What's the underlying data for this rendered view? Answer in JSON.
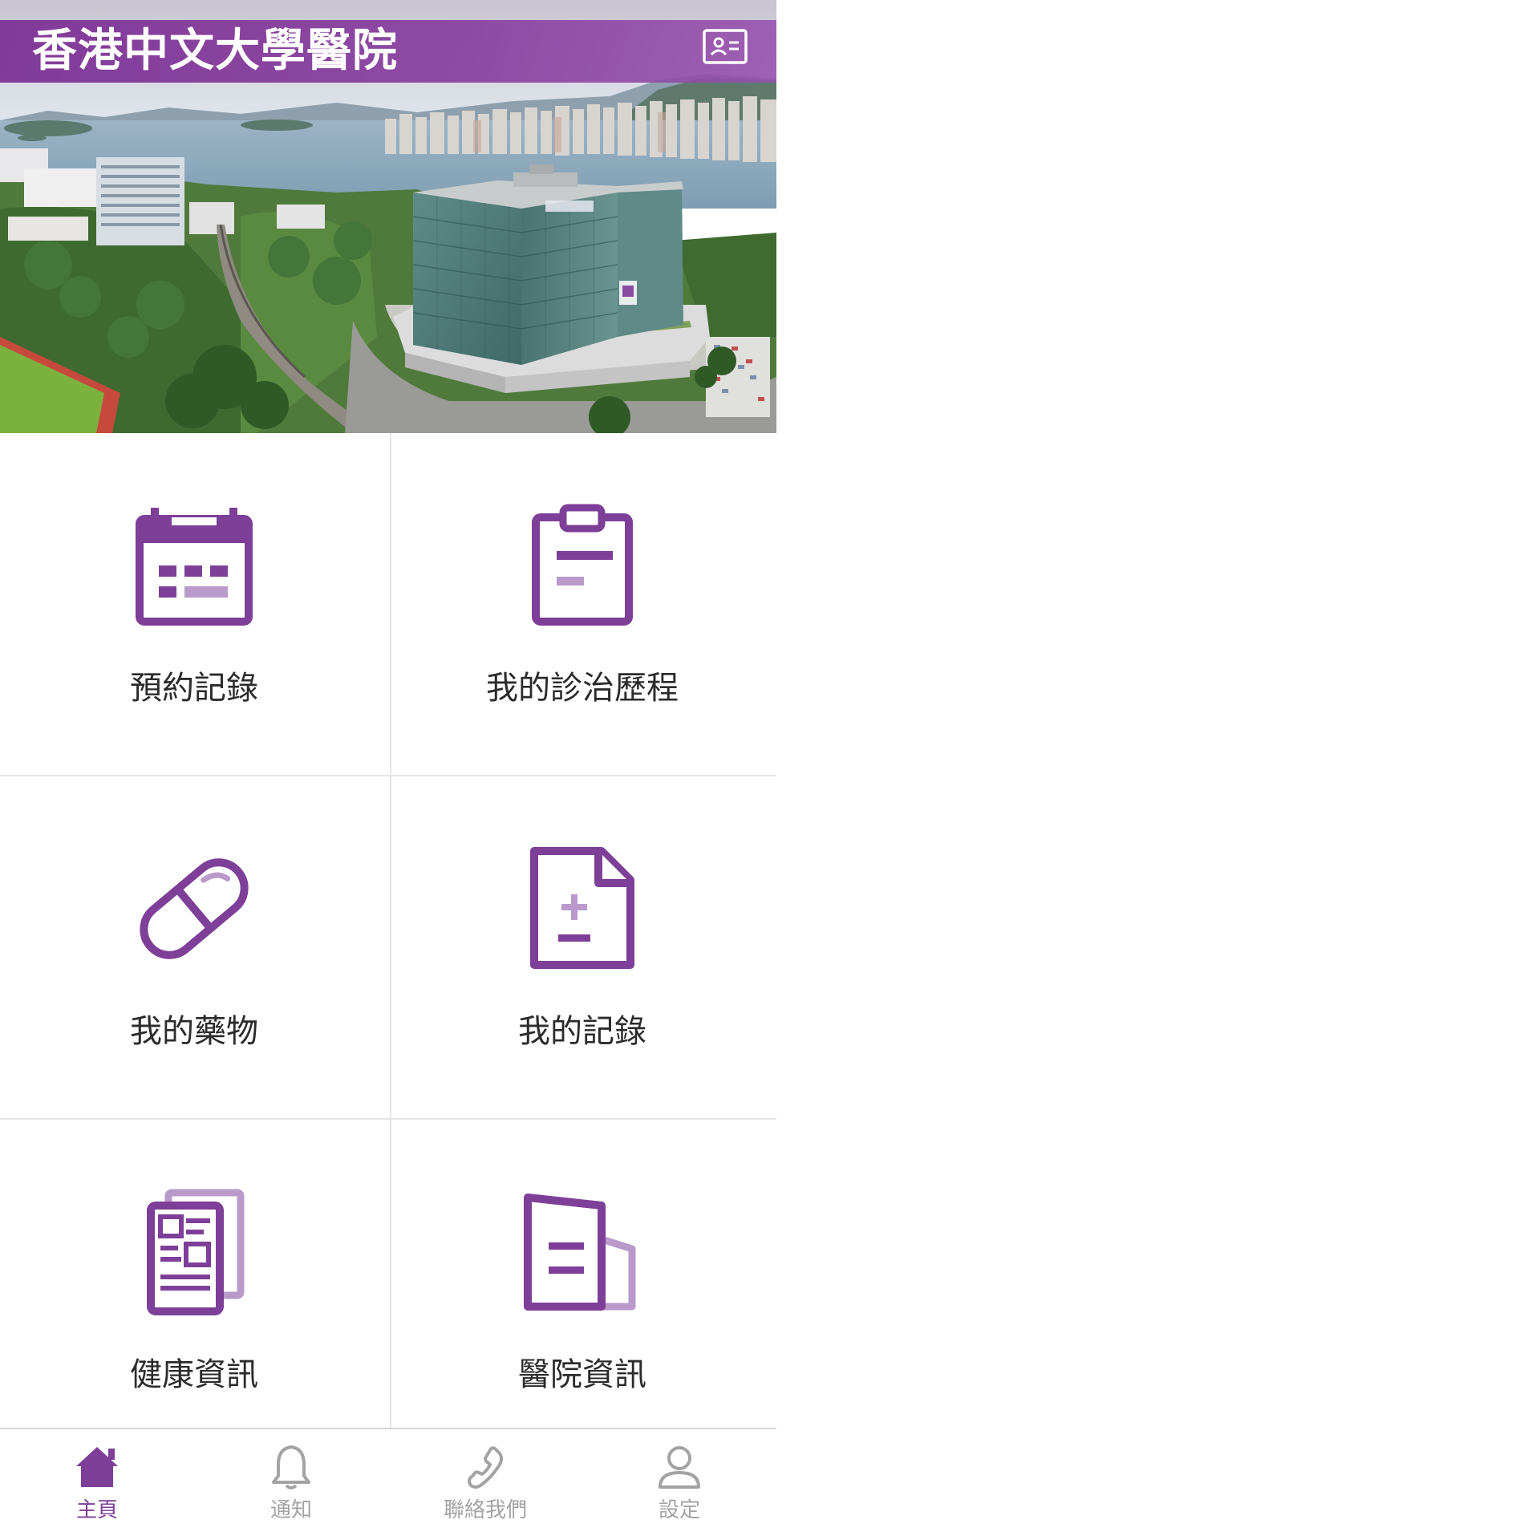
{
  "header": {
    "title": "香港中文大學醫院",
    "id_card_icon": "id-card-icon"
  },
  "hero": {
    "image": "hospital-aerial-photo"
  },
  "colors": {
    "primary": "#7e3f98",
    "primary_light": "#b99acb",
    "label_text": "#2b2b2b",
    "inactive_nav": "#a3a3a3",
    "divider": "#e6e6e6"
  },
  "tiles": [
    {
      "label": "預約記錄",
      "icon": "calendar-icon"
    },
    {
      "label": "我的診治歷程",
      "icon": "clipboard-icon"
    },
    {
      "label": "我的藥物",
      "icon": "pill-icon"
    },
    {
      "label": "我的記錄",
      "icon": "medical-document-icon"
    },
    {
      "label": "健康資訊",
      "icon": "newspaper-icon"
    },
    {
      "label": "醫院資訊",
      "icon": "hospital-building-icon"
    }
  ],
  "nav": {
    "active": "主頁",
    "items": [
      {
        "label": "主頁",
        "icon": "home-icon"
      },
      {
        "label": "通知",
        "icon": "bell-icon"
      },
      {
        "label": "聯絡我們",
        "icon": "phone-icon"
      },
      {
        "label": "設定",
        "icon": "user-icon"
      }
    ]
  }
}
